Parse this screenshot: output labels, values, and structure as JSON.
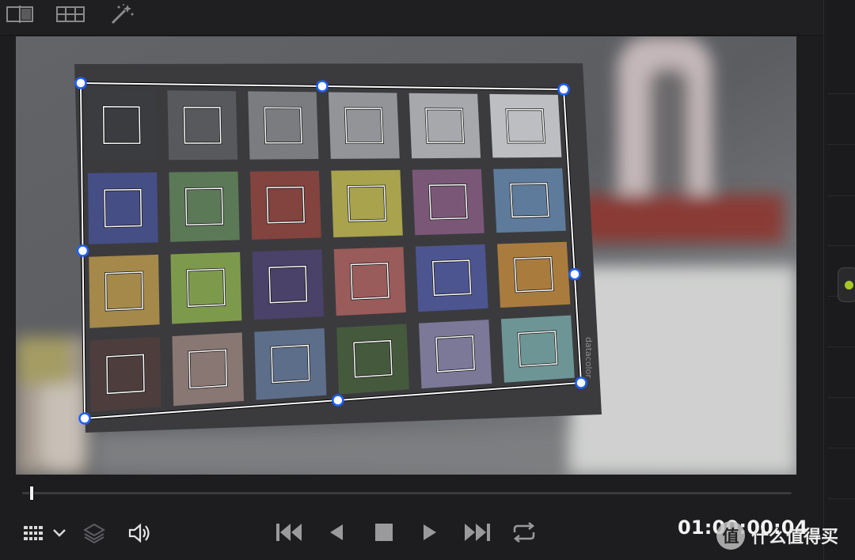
{
  "toolbar": {
    "icons": [
      "split-view-icon",
      "gallery-grid-icon",
      "magic-wand-icon"
    ]
  },
  "viewer": {
    "chart_brand": "datacolor",
    "patches": [
      "#3b3c3f",
      "#58595c",
      "#7b7c7f",
      "#939497",
      "#a7a8ab",
      "#bdbec1",
      "#464e86",
      "#5b7857",
      "#83433e",
      "#a8a34c",
      "#7a5777",
      "#5e7b9b",
      "#a4894a",
      "#7d9a4c",
      "#4a4269",
      "#9a5b5b",
      "#4d5590",
      "#a97c3e",
      "#4d3e3d",
      "#897774",
      "#5d6e8a",
      "#455a3c",
      "#7c7898",
      "#6e9595"
    ],
    "colors": {
      "handle_fill": "#ffffff",
      "handle_stroke": "#1f5fff",
      "chart_card": "#3b3b3e",
      "outline": "#ffffff"
    }
  },
  "transport": {
    "icons": [
      "viewer-grid-icon",
      "chevron-down-icon",
      "layers-icon",
      "volume-icon",
      "skip-to-start-icon",
      "play-reverse-icon",
      "stop-icon",
      "play-icon",
      "skip-to-end-icon",
      "loop-icon"
    ],
    "playhead_position": 0.006,
    "timecode": "01:00:00:04"
  },
  "watermark": {
    "logo_char": "值",
    "text": "什么值得买"
  }
}
